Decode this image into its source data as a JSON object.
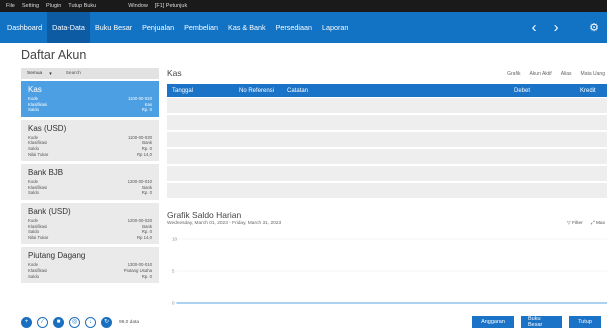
{
  "menubar": {
    "items": [
      "File",
      "Setting",
      "Plugin",
      "Tutup Buku"
    ],
    "right_items": [
      "Window",
      "[F1] Petunjuk"
    ]
  },
  "nav": {
    "tabs": [
      "Dashboard",
      "Data-Data",
      "Buku Besar",
      "Penjualan",
      "Pembelian",
      "Kas & Bank",
      "Persediaan",
      "Laporan"
    ],
    "active_tab": "Data-Data",
    "back_icon": "chevron-left-icon",
    "forward_icon": "chevron-right-icon",
    "settings_icon": "gear-icon"
  },
  "page": {
    "title": "Daftar Akun"
  },
  "filter": {
    "select_value": "Semua",
    "search_placeholder": "Search"
  },
  "accounts": [
    {
      "name": "Kas",
      "selected": true,
      "rows": [
        [
          "Kode",
          "1100-00-020"
        ],
        [
          "Klasifikasi",
          "Kas"
        ],
        [
          "Saldo",
          "Rp. 0"
        ]
      ]
    },
    {
      "name": "Kas (USD)",
      "selected": false,
      "rows": [
        [
          "Kode",
          "1100-00-030"
        ],
        [
          "Klasifikasi",
          "Bank"
        ],
        [
          "Saldo",
          "Rp. 0"
        ],
        [
          "Nilai Tukar",
          "Rp 14,0"
        ]
      ]
    },
    {
      "name": "Bank BJB",
      "selected": false,
      "rows": [
        [
          "Kode",
          "1200-00-010"
        ],
        [
          "Klasifikasi",
          "Bank"
        ],
        [
          "Saldo",
          "Rp. 0"
        ]
      ]
    },
    {
      "name": "Bank (USD)",
      "selected": false,
      "rows": [
        [
          "Kode",
          "1200-00-020"
        ],
        [
          "Klasifikasi",
          "Bank"
        ],
        [
          "Saldo",
          "Rp. 0"
        ],
        [
          "Nilai Tukar",
          "Rp 14,0"
        ]
      ]
    },
    {
      "name": "Piutang Dagang",
      "selected": false,
      "rows": [
        [
          "Kode",
          "1300-00-010"
        ],
        [
          "Klasifikasi",
          "Piutang Usaha"
        ],
        [
          "Saldo",
          "Rp. 0"
        ]
      ]
    }
  ],
  "footer_left": {
    "icons": [
      "add-icon",
      "edit-icon",
      "delete-icon",
      "view-icon",
      "download-icon",
      "refresh-icon"
    ],
    "count": "99,0 data"
  },
  "detail": {
    "title": "Kas",
    "tools": [
      "Grafik",
      "Akun Aktif",
      "Alias",
      "Mata Uang"
    ],
    "columns": [
      "Tanggal",
      "No Referensi",
      "Catatan",
      "Debet",
      "Kredit"
    ],
    "row_count": 6
  },
  "chart": {
    "title": "Grafik Saldo Harian",
    "range": "Wednesday, March 01, 2023 - Friday, March 31, 2023",
    "filter_label": "Filter",
    "max_label": "Max"
  },
  "chart_data": {
    "type": "line",
    "title": "Grafik Saldo Harian",
    "xlabel": "",
    "ylabel": "",
    "yticks": [
      "10",
      "5",
      "0"
    ],
    "ylim": [
      0,
      10
    ],
    "series": [
      {
        "values": [
          0
        ]
      }
    ]
  },
  "footer_right": {
    "buttons": [
      "Anggaran",
      "Buku Besar",
      "Tutup"
    ]
  }
}
